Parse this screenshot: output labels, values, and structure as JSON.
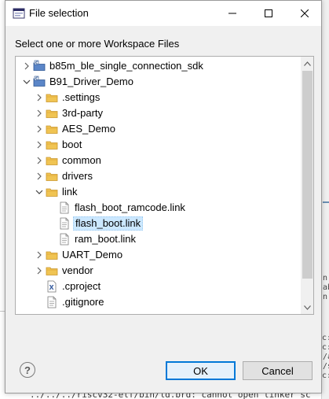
{
  "dialog": {
    "title": "File selection",
    "instruction": "Select one or more Workspace Files",
    "ok_label": "OK",
    "cancel_label": "Cancel",
    "help_label": "?"
  },
  "tree": {
    "items": [
      {
        "label": "b85m_ble_single_connection_sdk",
        "type": "project",
        "expanded": false
      },
      {
        "label": "B91_Driver_Demo",
        "type": "project",
        "expanded": true
      },
      {
        "label": ".settings",
        "type": "folder",
        "expanded": false
      },
      {
        "label": "3rd-party",
        "type": "folder",
        "expanded": false
      },
      {
        "label": "AES_Demo",
        "type": "folder",
        "expanded": false
      },
      {
        "label": "boot",
        "type": "folder",
        "expanded": false
      },
      {
        "label": "common",
        "type": "folder",
        "expanded": false
      },
      {
        "label": "drivers",
        "type": "folder",
        "expanded": false
      },
      {
        "label": "link",
        "type": "folder",
        "expanded": true
      },
      {
        "label": "flash_boot_ramcode.link",
        "type": "file"
      },
      {
        "label": "flash_boot.link",
        "type": "file",
        "selected": true
      },
      {
        "label": "ram_boot.link",
        "type": "file"
      },
      {
        "label": "UART_Demo",
        "type": "folder",
        "expanded": false
      },
      {
        "label": "vendor",
        "type": "folder",
        "expanded": false
      },
      {
        "label": ".cproject",
        "type": "xfile"
      },
      {
        "label": ".gitignore",
        "type": "file"
      }
    ]
  },
  "background": {
    "console_right": [
      "n",
      "ab",
      "n",
      "c:",
      "c:/",
      "/a",
      "/s",
      "c:"
    ],
    "console_bottom": "../../../riscv32-elf/bin/ld.brd: cannot open linker sc"
  },
  "colors": {
    "selection": "#cce8ff",
    "ok_border": "#0078d7",
    "folder": "#f0c453",
    "project_blue": "#3b6fb6"
  }
}
